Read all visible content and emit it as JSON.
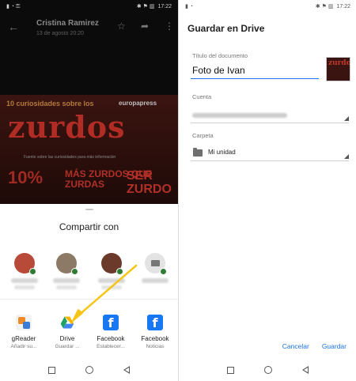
{
  "left": {
    "status": {
      "left_icons": "▮ ◔ ⚿",
      "right_icons": "✱ ⚑ ▥",
      "time": "17:22"
    },
    "email": {
      "sender": "Cristina Ramirez",
      "date": "13 de agosto 20:20"
    },
    "infographic": {
      "top_text": "10 curiosidades sobre los",
      "brand": "europapress",
      "title": "zurdos",
      "subtitle": "Fuente sobre las curiosidades para más información",
      "big_text": "10%",
      "mid_text": "MÁS ZURDOS QUE ZURDAS",
      "side_text": "SER ZURDO"
    },
    "share_sheet": {
      "title": "Compartir con",
      "apps": [
        {
          "name": "gReader",
          "sub": "Añadir su..."
        },
        {
          "name": "Drive",
          "sub": "Guardar ..."
        },
        {
          "name": "Facebook",
          "sub": "Establecer..."
        },
        {
          "name": "Facebook",
          "sub": "Noticias"
        }
      ]
    }
  },
  "right": {
    "status": {
      "right_icons": "✱ ⚑ ▥",
      "time": "17:22"
    },
    "title": "Guardar en Drive",
    "doc_label": "Título del documento",
    "doc_value": "Foto de Ivan",
    "account_label": "Cuenta",
    "folder_label": "Carpeta",
    "folder_value": "Mi unidad",
    "cancel_label": "Cancelar",
    "save_label": "Guardar",
    "thumb_text": "zurdos"
  },
  "colors": {
    "accent": "#1a73e8",
    "arrow": "#f5c518",
    "facebook": "#1877f2",
    "infographic_red": "#b02c24"
  }
}
